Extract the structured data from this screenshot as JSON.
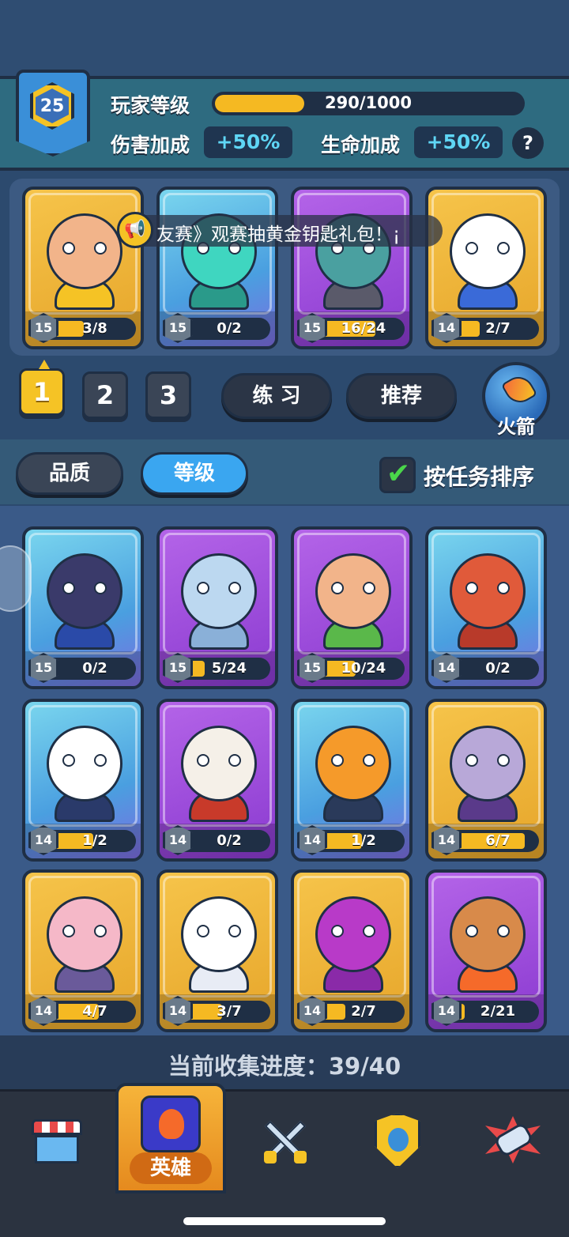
{
  "player": {
    "level": "25",
    "level_label": "玩家等级",
    "xp_text": "290/1000",
    "xp_fraction": 0.29,
    "damage_label": "伤害加成",
    "damage_value": "+50%",
    "health_label": "生命加成",
    "health_value": "+50%",
    "help": "?"
  },
  "marquee": "友赛》观赛抽黄金钥匙礼包！¡",
  "team": [
    {
      "name": "knight",
      "level": "15",
      "progress": "3/8",
      "fill": 0.375,
      "bg": "gold",
      "skin": "#f2b48a",
      "body": "#f5c325"
    },
    {
      "name": "ghost-knight",
      "level": "15",
      "progress": "0/2",
      "fill": 0,
      "bg": "blue",
      "skin": "#3fd6c0",
      "body": "#2a9a8a"
    },
    {
      "name": "orc",
      "level": "15",
      "progress": "16/24",
      "fill": 0.667,
      "bg": "purple",
      "skin": "#4aa0a0",
      "body": "#5a5a6a"
    },
    {
      "name": "cat-priest",
      "level": "14",
      "progress": "2/7",
      "fill": 0.286,
      "bg": "gold",
      "skin": "#ffffff",
      "body": "#3a6ad8"
    }
  ],
  "decks": [
    "1",
    "2",
    "3"
  ],
  "buttons": {
    "practice": "练 习",
    "recommend": "推荐",
    "rocket": "火箭"
  },
  "sort": {
    "quality": "品质",
    "level": "等级",
    "by_task": "按任务排序",
    "check": "✔"
  },
  "heroes": [
    {
      "name": "anubis",
      "level": "15",
      "progress": "0/2",
      "fill": 0,
      "bg": "blue",
      "skin": "#3a3a6a",
      "body": "#2a4aa8"
    },
    {
      "name": "yeti",
      "level": "15",
      "progress": "5/24",
      "fill": 0.208,
      "bg": "purple",
      "skin": "#bcd8f0",
      "body": "#8ab0d8"
    },
    {
      "name": "dryad",
      "level": "15",
      "progress": "10/24",
      "fill": 0.417,
      "bg": "purple",
      "skin": "#f2b48a",
      "body": "#5ab84a"
    },
    {
      "name": "dragon",
      "level": "14",
      "progress": "0/2",
      "fill": 0,
      "bg": "blue",
      "skin": "#e05a3a",
      "body": "#b83a2a"
    },
    {
      "name": "panda",
      "level": "14",
      "progress": "1/2",
      "fill": 0.5,
      "bg": "blue",
      "skin": "#ffffff",
      "body": "#2a3a6a"
    },
    {
      "name": "monkey-king",
      "level": "14",
      "progress": "0/2",
      "fill": 0,
      "bg": "purple",
      "skin": "#f5f0e8",
      "body": "#c83a2a"
    },
    {
      "name": "pumpkin",
      "level": "14",
      "progress": "1/2",
      "fill": 0.5,
      "bg": "blue",
      "skin": "#f59a2a",
      "body": "#2a3a5a"
    },
    {
      "name": "maid",
      "level": "14",
      "progress": "6/7",
      "fill": 0.857,
      "bg": "gold",
      "skin": "#b8a8d8",
      "body": "#5a3a8a"
    },
    {
      "name": "fox-girl",
      "level": "14",
      "progress": "4/7",
      "fill": 0.571,
      "bg": "gold",
      "skin": "#f5b8c8",
      "body": "#6a5a9a"
    },
    {
      "name": "cloud",
      "level": "14",
      "progress": "3/7",
      "fill": 0.429,
      "bg": "gold",
      "skin": "#ffffff",
      "body": "#e8ecf5"
    },
    {
      "name": "spider",
      "level": "14",
      "progress": "2/7",
      "fill": 0.286,
      "bg": "gold",
      "skin": "#b83ac8",
      "body": "#8a2aa8"
    },
    {
      "name": "fire-spirit",
      "level": "14",
      "progress": "2/21",
      "fill": 0.095,
      "bg": "purple",
      "skin": "#d88a4a",
      "body": "#f56a2a"
    }
  ],
  "collection": "当前收集进度：39/40",
  "nav": {
    "heroes_label": "英雄"
  }
}
